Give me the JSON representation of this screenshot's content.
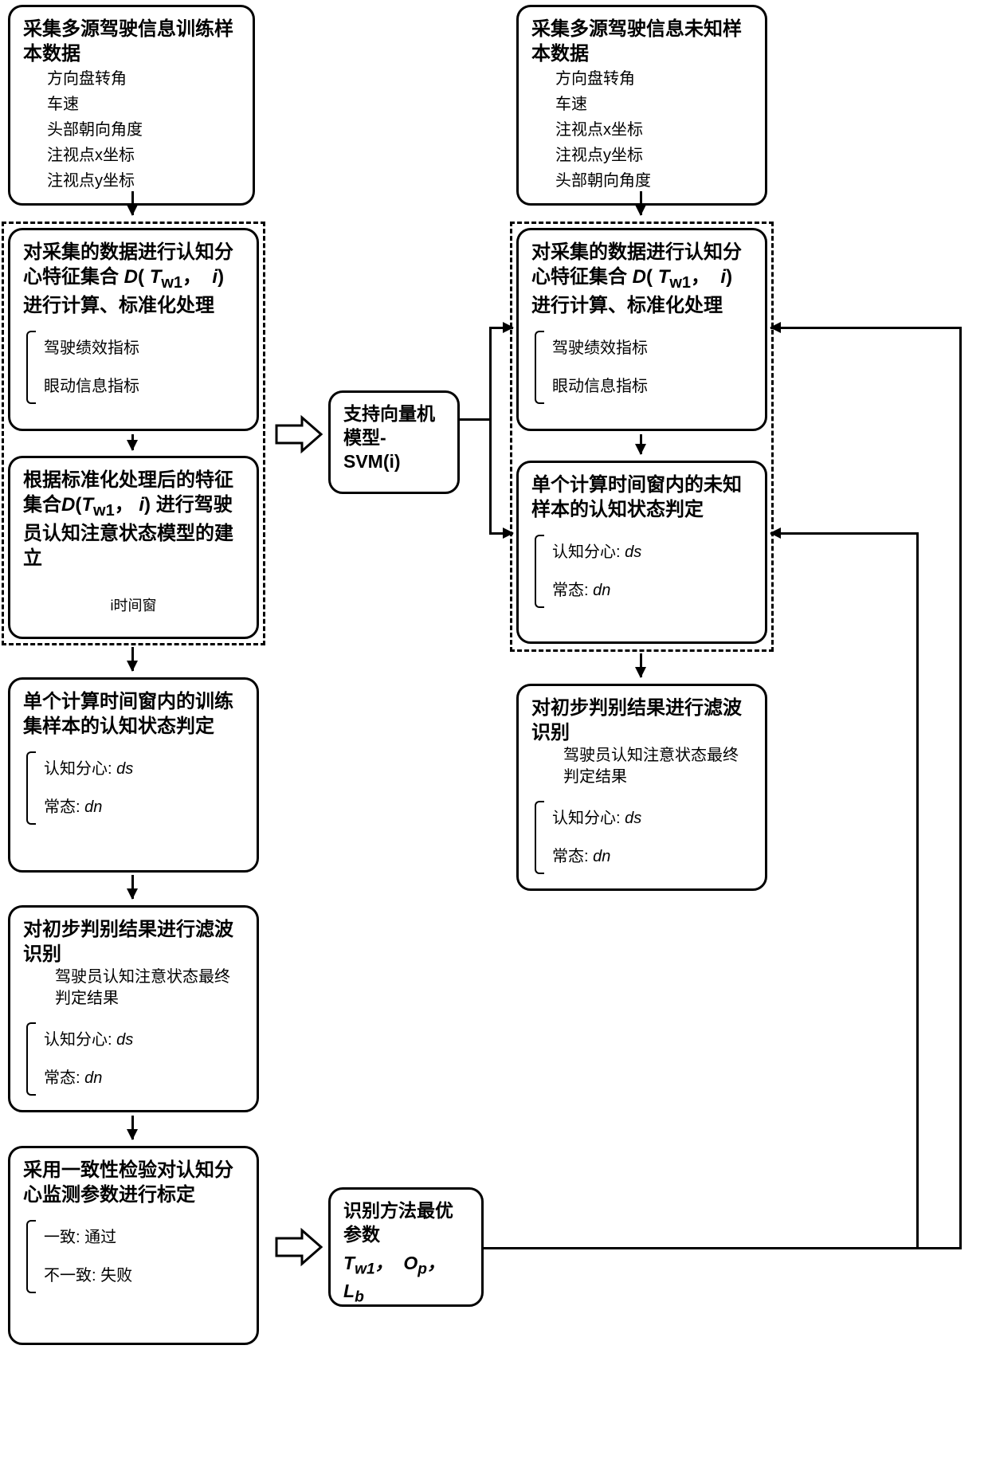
{
  "left": {
    "b1_title": "采集多源驾驶信息训练样本数据",
    "b1_items": [
      "方向盘转角",
      "车速",
      "头部朝向角度",
      "注视点x坐标",
      "注视点y坐标"
    ],
    "b2_title_a": "对采集的数据进行认知分心特征集合",
    "b2_title_b": "进行计算、标准化处理",
    "b2_items": [
      "驾驶绩效指标",
      "眼动信息指标"
    ],
    "b3_title_a": "根据标准化处理后的特征集合",
    "b3_title_b": "进行驾驶员认知注意状态模型的建立",
    "b3_note": "i时间窗",
    "b4_title": "单个计算时间窗内的训练集样本的认知状态判定",
    "b4_items": [
      "认知分心: ",
      "常态: "
    ],
    "b5_title": "对初步判别结果进行滤波识别",
    "b5_sub": "驾驶员认知注意状态最终判定结果",
    "b5_items": [
      "认知分心: ",
      "常态: "
    ],
    "b6_title": "采用一致性检验对认知分心监测参数进行标定",
    "b6_items": [
      "一致: 通过",
      "不一致: 失败"
    ]
  },
  "mid": {
    "svm_title_a": "支持向量机模型-",
    "svm_title_b": "SVM(i)",
    "opt_title": "识别方法最优参数",
    "opt_params_a": "T",
    "opt_params_b": "O",
    "opt_params_c": "L"
  },
  "right": {
    "r1_title": "采集多源驾驶信息未知样本数据",
    "r1_items": [
      "方向盘转角",
      "车速",
      "注视点x坐标",
      "注视点y坐标",
      "头部朝向角度"
    ],
    "r2_title_a": "对采集的数据进行认知分心特征集合",
    "r2_title_b": "进行计算、标准化处理",
    "r2_items": [
      "驾驶绩效指标",
      "眼动信息指标"
    ],
    "r3_title": "单个计算时间窗内的未知样本的认知状态判定",
    "r3_items": [
      "认知分心: ",
      "常态: "
    ],
    "r4_title": "对初步判别结果进行滤波识别",
    "r4_sub": "驾驶员认知注意状态最终判定结果",
    "r4_items": [
      "认知分心: ",
      "常态: "
    ]
  },
  "sym": {
    "D": "D",
    "T": "T",
    "w1": "w1",
    "i": "i",
    "ds": "ds",
    "dn": "dn",
    "p": "p",
    "b": "b"
  }
}
